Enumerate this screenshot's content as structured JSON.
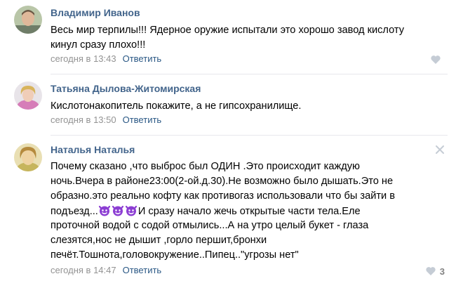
{
  "comments": [
    {
      "author": "Владимир Иванов",
      "lines": [
        "Весь мир терпилы!!! Ядерное оружие испытали это хорошо завод кислоту",
        "кинул сразу плохо!!!"
      ],
      "time": "сегодня в 13:43",
      "reply_label": "Ответить",
      "likes": ""
    },
    {
      "author": "Татьяна Дылова-Житомирская",
      "lines": [
        "Кислотонакопитель покажите, а не гипсохранилище."
      ],
      "time": "сегодня в 13:50",
      "reply_label": "Ответить",
      "likes": ""
    },
    {
      "author": "Наталья Наталья",
      "lines": [
        "Почему сказано ,что выброс был ОДИН .Это происходит каждую",
        "ночь.Вчера в районе23:00(2-ой.д.30).Не возможно было дышать.Это не",
        "образно.это реально кофту как противогаз использовали что бы зайти в",
        "подъезд...",
        "И сразу начало жечь открытые части тела.Еле",
        "проточной водой с содой отмылись...А на утро целый букет - глаза",
        "слезятся,нос не дышит ,горло першит,бронхи",
        "печёт.Тошнота,головокружение..Пипец..\"угрозы нет\""
      ],
      "time": "сегодня в 14:47",
      "reply_label": "Ответить",
      "likes": "3"
    }
  ],
  "icons": {
    "like": "heart-icon",
    "close": "close-icon",
    "emoji": "smiling-imp-emoji"
  },
  "colors": {
    "author": "#42648b",
    "reply": "#2a5885",
    "meta": "#939393",
    "icon": "#c5ccd5",
    "emoji": "#8c3ed3"
  }
}
